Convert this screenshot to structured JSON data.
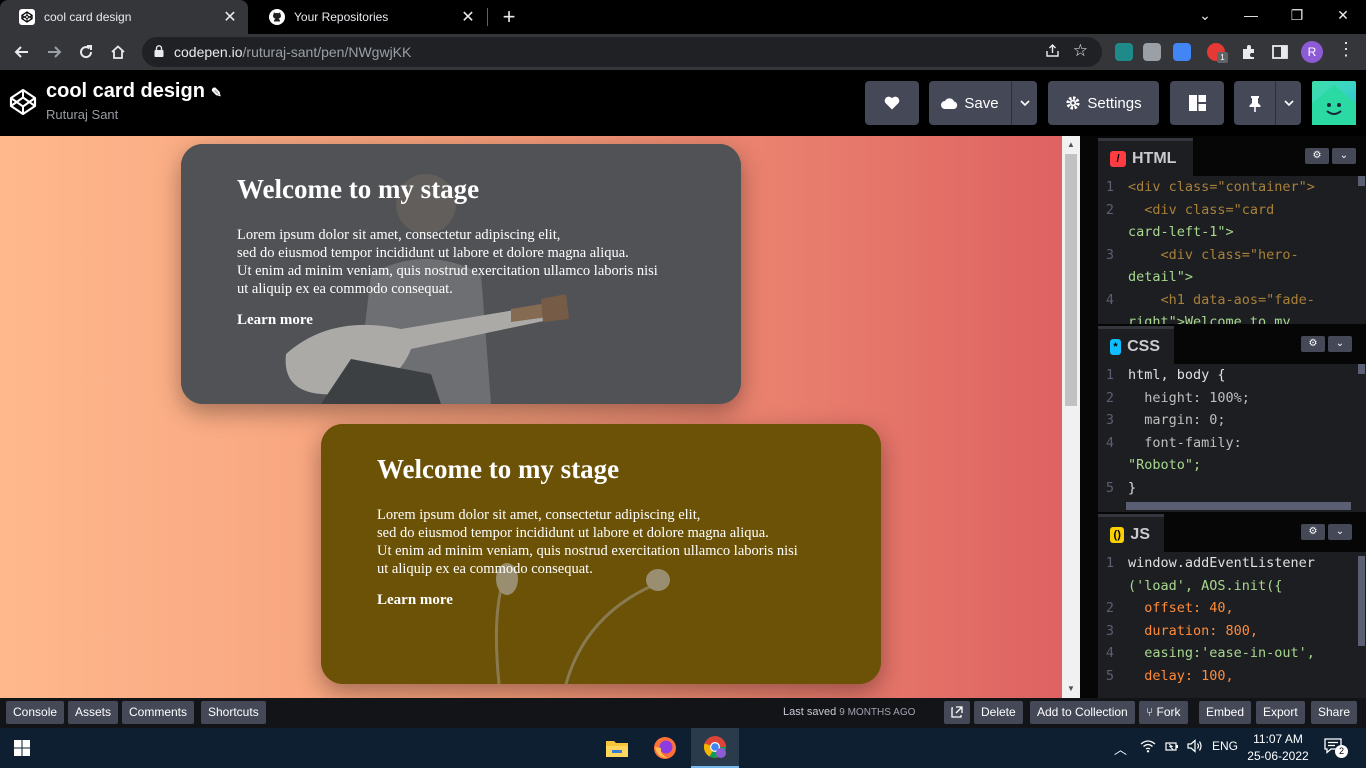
{
  "browser": {
    "tabs": [
      {
        "title": "cool card design",
        "icon": "codepen-icon",
        "active": true
      },
      {
        "title": "Your Repositories",
        "icon": "github-icon",
        "active": false
      }
    ],
    "close_glyph": "✕",
    "newtab_glyph": "+",
    "window_controls": [
      "⌄",
      "—",
      "❐",
      "✕"
    ],
    "url_host": "codepen.io",
    "url_path": "/ruturaj-sant/pen/NWgwjKK",
    "profile_initial": "R",
    "extension_badge": "1"
  },
  "codepen": {
    "pen_title": "cool card design",
    "author": "Ruturaj Sant",
    "save_label": "Save",
    "settings_label": "Settings"
  },
  "preview": {
    "cards": [
      {
        "title": "Welcome to my stage",
        "lines": [
          "Lorem ipsum dolor sit amet, consectetur adipiscing elit,",
          "sed do eiusmod tempor incididunt ut labore et dolore magna aliqua.",
          "Ut enim ad minim veniam, quis nostrud exercitation ullamco laboris nisi",
          "ut aliquip ex ea commodo consequat."
        ],
        "link": "Learn more"
      },
      {
        "title": "Welcome to my stage",
        "lines": [
          "Lorem ipsum dolor sit amet, consectetur adipiscing elit,",
          "sed do eiusmod tempor incididunt ut labore et dolore magna aliqua.",
          "Ut enim ad minim veniam, quis nostrud exercitation ullamco laboris nisi",
          "ut aliquip ex ea commodo consequat."
        ],
        "link": "Learn more"
      }
    ]
  },
  "editors": {
    "html": {
      "label": "HTML",
      "lines": [
        {
          "n": "1",
          "code": "<div class=\"container\">"
        },
        {
          "n": "2",
          "code": "  <div class=\"card"
        },
        {
          "n": "",
          "code": "card-left-1\">"
        },
        {
          "n": "3",
          "code": "    <div class=\"hero-"
        },
        {
          "n": "",
          "code": "detail\">"
        },
        {
          "n": "4",
          "code": "    <h1 data-aos=\"fade-"
        },
        {
          "n": "",
          "code": "right\">Welcome to my"
        }
      ]
    },
    "css": {
      "label": "CSS",
      "lines": [
        {
          "n": "1",
          "code": "html, body {"
        },
        {
          "n": "2",
          "code": "  height: 100%;"
        },
        {
          "n": "3",
          "code": "  margin: 0;"
        },
        {
          "n": "4",
          "code": "  font-family:"
        },
        {
          "n": "",
          "code": "\"Roboto\";"
        },
        {
          "n": "5",
          "code": "}"
        }
      ]
    },
    "js": {
      "label": "JS",
      "lines": [
        {
          "n": "1",
          "code": "window.addEventListener"
        },
        {
          "n": "",
          "code": "('load', AOS.init({"
        },
        {
          "n": "2",
          "code": "  offset: 40,"
        },
        {
          "n": "3",
          "code": "  duration: 800,"
        },
        {
          "n": "4",
          "code": "  easing:'ease-in-out',"
        },
        {
          "n": "5",
          "code": "  delay: 100,"
        }
      ]
    }
  },
  "footer": {
    "left_buttons": [
      "Console",
      "Assets",
      "Comments",
      "Shortcuts"
    ],
    "last_saved_label": "Last saved",
    "last_saved_ago": "9 MONTHS AGO",
    "right_buttons": [
      "Delete",
      "Add to Collection",
      "Fork",
      "Embed",
      "Export",
      "Share"
    ]
  },
  "taskbar": {
    "language": "ENG",
    "time": "11:07 AM",
    "date": "25-06-2022",
    "notifications": "2"
  },
  "colors": {
    "codepen_button": "#444857",
    "preview_gradient_start": "#ffb88c",
    "preview_gradient_end": "#de6262",
    "html_badge": "#ff3c41",
    "css_badge": "#0ebeff",
    "js_badge": "#fcd000"
  }
}
